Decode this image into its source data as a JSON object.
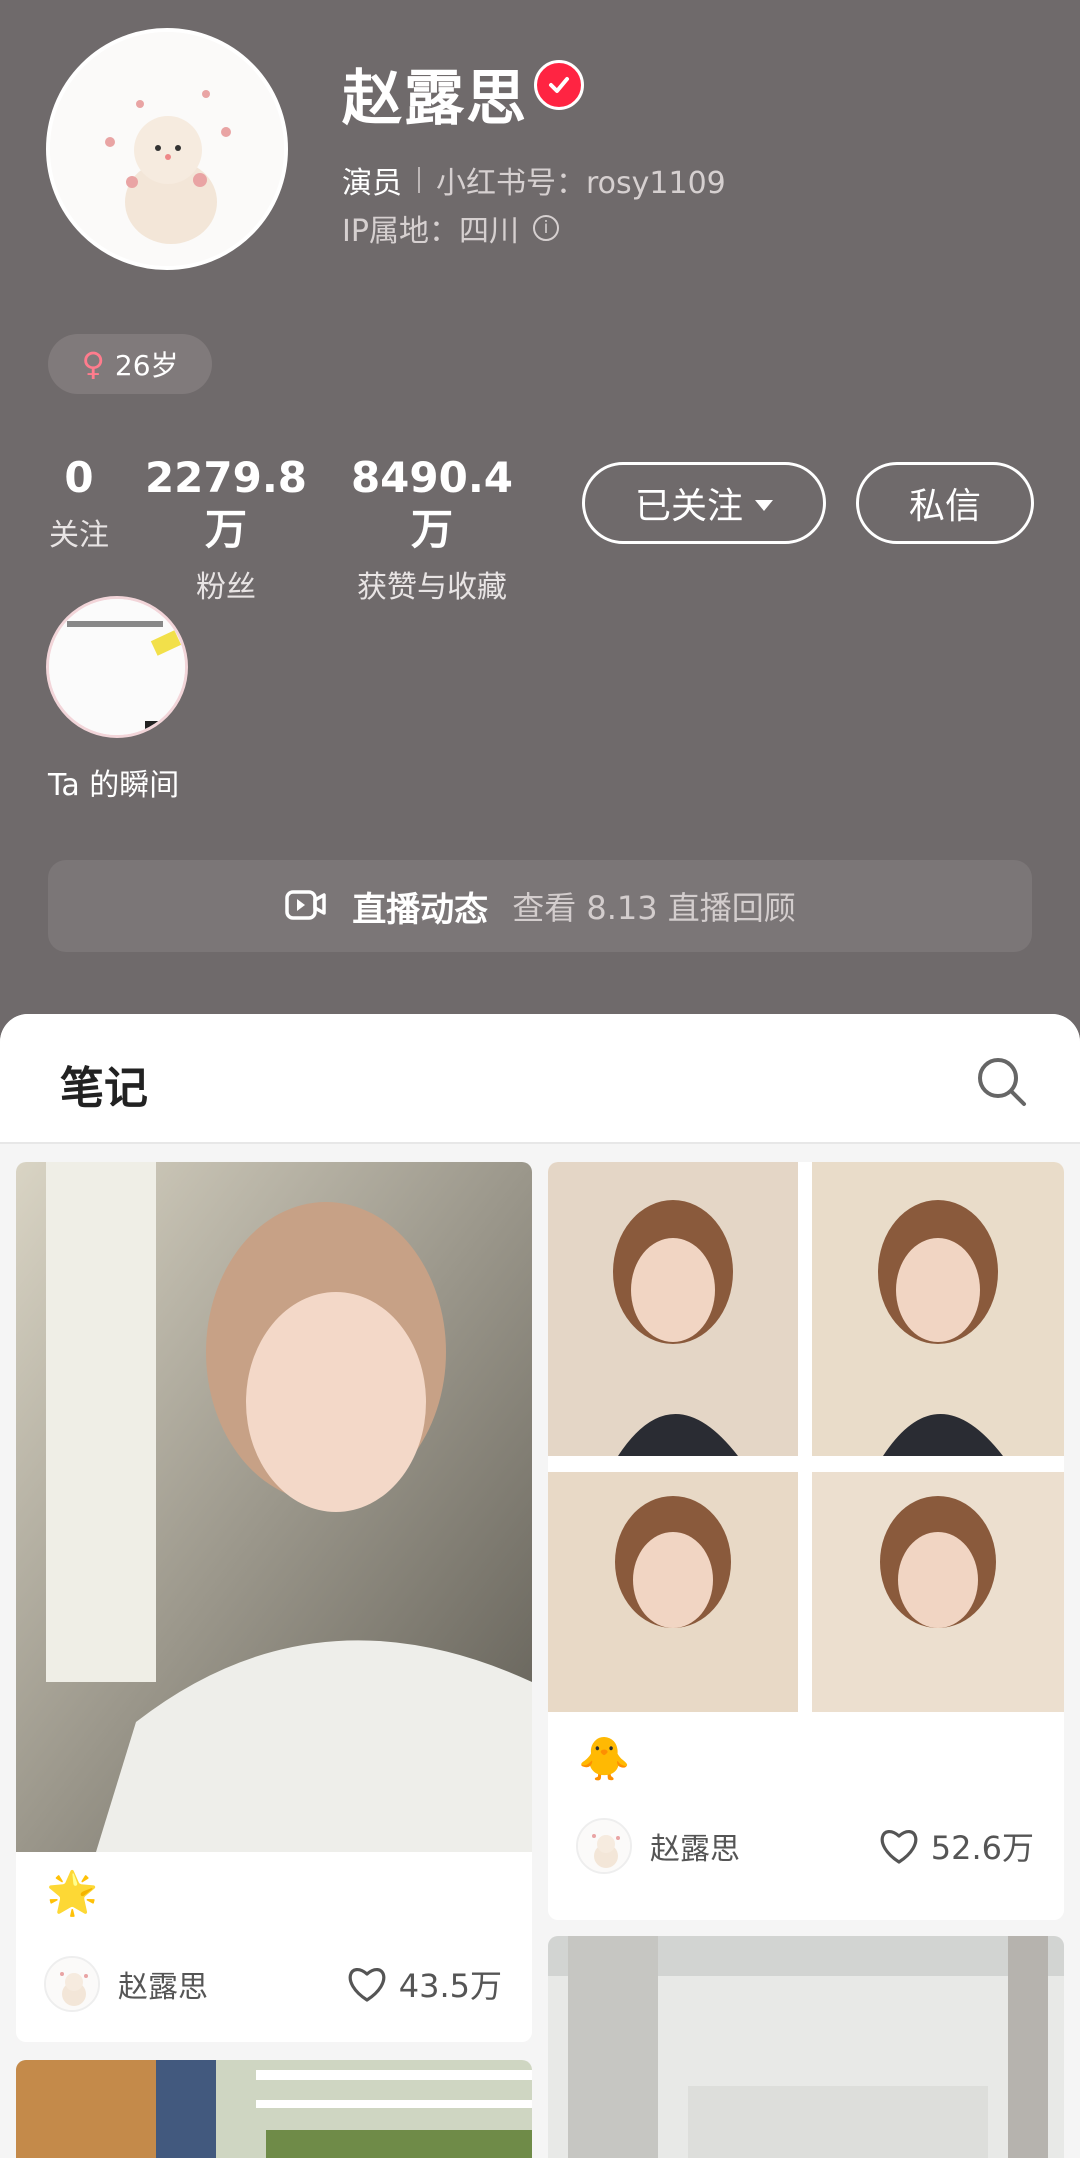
{
  "profile": {
    "name": "赵露思",
    "role": "演员",
    "id_label": "小红书号：rosy1109",
    "ip_label": "IP属地：四川",
    "age_tag": "26岁"
  },
  "stats": [
    {
      "num": "0",
      "label": "关注"
    },
    {
      "num": "2279.8万",
      "label": "粉丝"
    },
    {
      "num": "8490.4万",
      "label": "获赞与收藏"
    }
  ],
  "actions": {
    "follow_label": "已关注",
    "dm_label": "私信"
  },
  "moment": {
    "label": "Ta 的瞬间"
  },
  "live": {
    "title": "直播动态",
    "subtitle": "查看 8.13 直播回顾"
  },
  "notes": {
    "title": "笔记",
    "cards": [
      {
        "emoji": "🌟",
        "author": "赵露思",
        "likes": "43.5万"
      },
      {
        "emoji": "🐥",
        "author": "赵露思",
        "likes": "52.6万"
      }
    ]
  },
  "colors": {
    "header_bg": "#6f6a6b",
    "verified": "#ff2442",
    "female": "#ff7c8d"
  }
}
